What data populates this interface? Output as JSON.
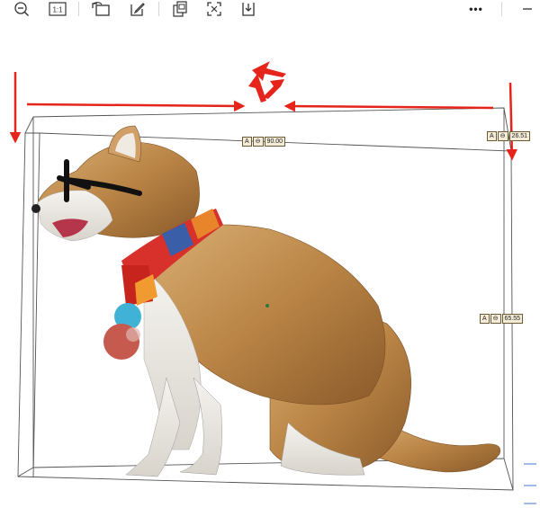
{
  "toolbar": {
    "buttons": [
      {
        "name": "zoom-out-icon"
      },
      {
        "name": "actual-size-icon",
        "label": "1:1"
      },
      {
        "name": "rotate-icon"
      },
      {
        "name": "edit-icon"
      },
      {
        "name": "copy-icon"
      },
      {
        "name": "fit-to-screen-icon"
      },
      {
        "name": "download-icon"
      },
      {
        "name": "more-icon",
        "label": "•••"
      },
      {
        "name": "minimize-icon"
      }
    ]
  },
  "dimensions": {
    "height_tag": {
      "a_label": "A",
      "value": "90.00"
    },
    "angle_tag": {
      "a_label": "A",
      "value": "26.51"
    },
    "depth_tag": {
      "a_label": "A",
      "value": "65.55"
    }
  },
  "colors": {
    "arrow": "#e5251c",
    "bbox": "#555555",
    "fur": "#c9924f",
    "scarf_red": "#d8302a",
    "scarf_blue": "#3a5fa8"
  }
}
